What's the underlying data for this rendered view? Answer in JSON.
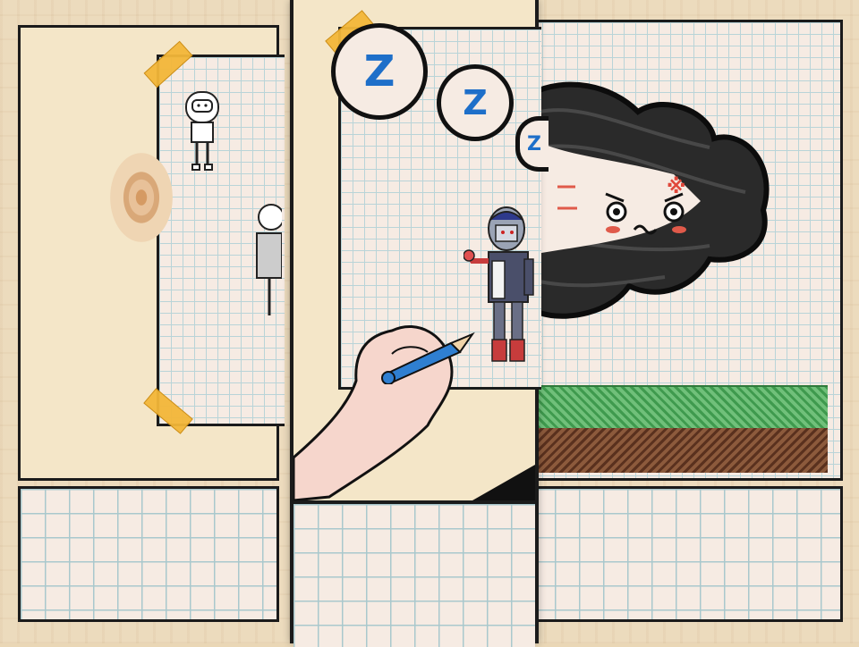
{
  "scene": {
    "description_hidden": "",
    "panels": {
      "left": {
        "name": "left-comic-panel"
      },
      "center": {
        "name": "center-comic-panel"
      },
      "right": {
        "name": "right-comic-panel"
      }
    },
    "sleep_bubbles": [
      "Z",
      "Z",
      "Z"
    ],
    "cloud_face": {
      "eyes": "o   o",
      "mouth": "~",
      "anger_mark": "※",
      "speed_lines": "= ="
    },
    "colors": {
      "paper": "#f6ebe3",
      "grid_line": "#b9d4d8",
      "tape": "#f3b739",
      "grass": "#5fae62",
      "dirt": "#7a4a30",
      "z_blue": "#1e6fc9",
      "cloud": "#1a1a1a",
      "cheek": "#e05a4a",
      "pencil": "#2f7fd1",
      "skin": "#f6d6cc"
    },
    "icons": [
      "sleep-z-icon",
      "anger-mark-icon",
      "pencil-icon"
    ]
  }
}
